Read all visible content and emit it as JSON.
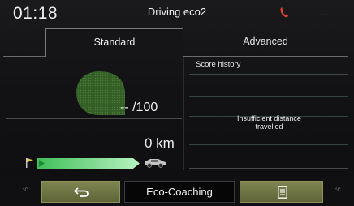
{
  "status": {
    "time": "01:18",
    "title": "Driving eco2",
    "phone_icon": "phone-icon",
    "signal_text": "---"
  },
  "tabs": [
    {
      "label": "Standard",
      "active": true
    },
    {
      "label": "Advanced",
      "active": false
    }
  ],
  "standard": {
    "score_text": "-- /100",
    "distance_text": "0 km",
    "progress_icon_start": "flag-icon",
    "progress_icon_end": "car-icon"
  },
  "history": {
    "label": "Score history",
    "message_line1": "Insufficient distance",
    "message_line2": "travelled"
  },
  "bottom": {
    "center_label": "Eco-Coaching",
    "back_icon": "back-arrow-icon",
    "menu_icon": "list-icon",
    "temp_left": "°C",
    "temp_right": "°C"
  },
  "colors": {
    "accent": "#7e8451",
    "leaf": "#3b6a2b",
    "progress": "#7fe08a",
    "phone": "#e0422f"
  }
}
